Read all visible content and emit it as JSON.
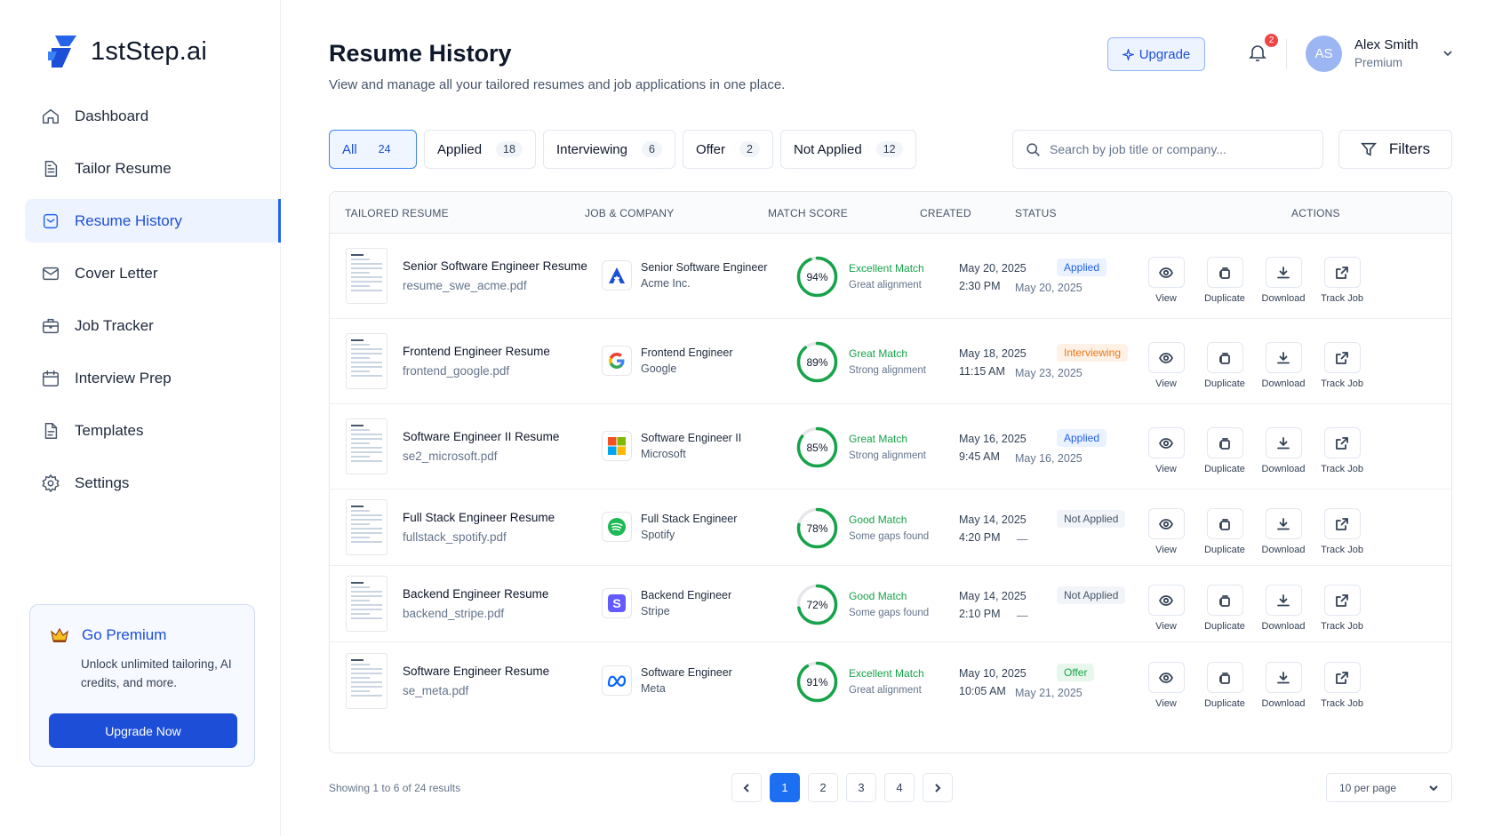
{
  "brand": {
    "name": "1stStep.ai",
    "accent": "#2563eb"
  },
  "sidebar": {
    "items": [
      {
        "label": "Dashboard",
        "icon": "home-icon"
      },
      {
        "label": "Tailor Resume",
        "icon": "document-icon"
      },
      {
        "label": "Resume History",
        "icon": "history-icon",
        "active": true
      },
      {
        "label": "Cover Letter",
        "icon": "mail-icon"
      },
      {
        "label": "Job Tracker",
        "icon": "briefcase-icon"
      },
      {
        "label": "Interview Prep",
        "icon": "calendar-icon"
      },
      {
        "label": "Templates",
        "icon": "template-icon"
      },
      {
        "label": "Settings",
        "icon": "gear-icon"
      }
    ],
    "premium": {
      "title": "Go Premium",
      "text": "Unlock unlimited tailoring, AI credits, and more.",
      "button": "Upgrade Now"
    }
  },
  "header": {
    "title": "Resume History",
    "subtitle": "View and manage all your tailored resumes and job applications in one place.",
    "upgrade": "Upgrade",
    "notifications": "2",
    "user": {
      "initials": "AS",
      "name": "Alex Smith",
      "plan": "Premium"
    }
  },
  "filters": {
    "tabs": [
      {
        "label": "All",
        "count": "24",
        "active": true
      },
      {
        "label": "Applied",
        "count": "18"
      },
      {
        "label": "Interviewing",
        "count": "6"
      },
      {
        "label": "Offer",
        "count": "2"
      },
      {
        "label": "Not Applied",
        "count": "12"
      }
    ],
    "search_placeholder": "Search by job title or company...",
    "filters_label": "Filters"
  },
  "table": {
    "columns": [
      "TAILORED RESUME",
      "JOB & COMPANY",
      "MATCH SCORE",
      "CREATED",
      "STATUS",
      "ACTIONS"
    ],
    "actions": [
      "View",
      "Duplicate",
      "Download",
      "Track Job"
    ],
    "rows": [
      {
        "title": "Senior Software Engineer Resume",
        "file": "resume_swe_acme.pdf",
        "job": "Senior Software Engineer",
        "company": "Acme Inc.",
        "logo": "acme",
        "score": 94,
        "score_text": "94%",
        "match": "Excellent Match",
        "match_sub": "Great alignment",
        "date": "May 20, 2025",
        "time": "2:30 PM",
        "status": "Applied",
        "status_type": "applied",
        "status_date": "May 20, 2025"
      },
      {
        "title": "Frontend Engineer Resume",
        "file": "frontend_google.pdf",
        "job": "Frontend Engineer",
        "company": "Google",
        "logo": "google",
        "score": 89,
        "score_text": "89%",
        "match": "Great Match",
        "match_sub": "Strong alignment",
        "date": "May 18, 2025",
        "time": "11:15 AM",
        "status": "Interviewing",
        "status_type": "interviewing",
        "status_date": "May 23, 2025"
      },
      {
        "title": "Software Engineer II Resume",
        "file": "se2_microsoft.pdf",
        "job": "Software Engineer II",
        "company": "Microsoft",
        "logo": "microsoft",
        "score": 85,
        "score_text": "85%",
        "match": "Great Match",
        "match_sub": "Strong alignment",
        "date": "May 16, 2025",
        "time": "9:45 AM",
        "status": "Applied",
        "status_type": "applied",
        "status_date": "May 16, 2025"
      },
      {
        "title": "Full Stack Engineer Resume",
        "file": "fullstack_spotify.pdf",
        "job": "Full Stack Engineer",
        "company": "Spotify",
        "logo": "spotify",
        "score": 78,
        "score_text": "78%",
        "match": "Good Match",
        "match_sub": "Some gaps found",
        "date": "May 14, 2025",
        "time": "4:20 PM",
        "status": "Not Applied",
        "status_type": "not",
        "status_date": "—"
      },
      {
        "title": "Backend Engineer Resume",
        "file": "backend_stripe.pdf",
        "job": "Backend Engineer",
        "company": "Stripe",
        "logo": "stripe",
        "score": 72,
        "score_text": "72%",
        "match": "Good Match",
        "match_sub": "Some gaps found",
        "date": "May 14, 2025",
        "time": "2:10 PM",
        "status": "Not Applied",
        "status_type": "not",
        "status_date": "—"
      },
      {
        "title": "Software Engineer Resume",
        "file": "se_meta.pdf",
        "job": "Software Engineer",
        "company": "Meta",
        "logo": "meta",
        "score": 91,
        "score_text": "91%",
        "match": "Excellent Match",
        "match_sub": "Great alignment",
        "date": "May 10, 2025",
        "time": "10:05 AM",
        "status": "Offer",
        "status_type": "offer",
        "status_date": "May 21, 2025"
      }
    ]
  },
  "footer": {
    "showing": "Showing 1 to 6 of 24 results",
    "pages": [
      "1",
      "2",
      "3",
      "4"
    ],
    "current_page": "1",
    "per_page": "10 per page"
  }
}
